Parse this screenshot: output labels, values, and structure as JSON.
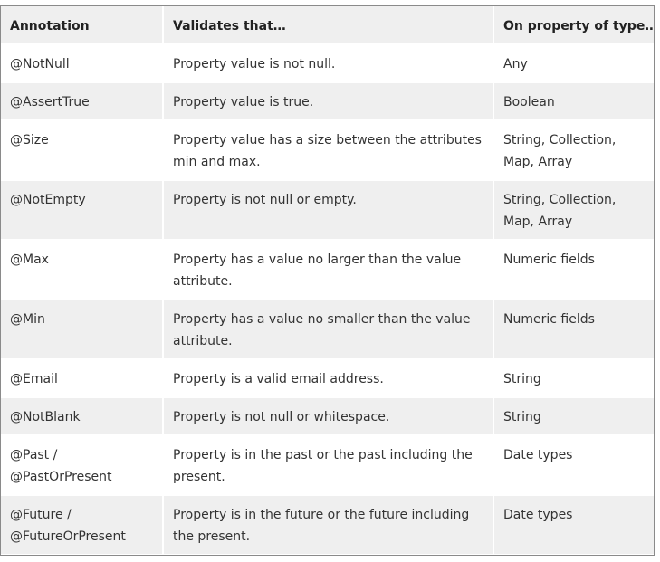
{
  "table": {
    "headers": [
      "Annotation",
      "Validates that…",
      "On property of type…"
    ],
    "rows": [
      [
        "@NotNull",
        "Property value is not null.",
        "Any"
      ],
      [
        "@AssertTrue",
        "Property value is true.",
        "Boolean"
      ],
      [
        "@Size",
        "Property value has a size between the attributes min and max.",
        "String, Collection, Map, Array"
      ],
      [
        "@NotEmpty",
        "Property is not null or empty.",
        "String, Collection, Map, Array"
      ],
      [
        "@Max",
        "Property has a value no larger than the value attribute.",
        "Numeric fields"
      ],
      [
        "@Min",
        "Property has a value no smaller than the value attribute.",
        "Numeric fields"
      ],
      [
        "@Email",
        "Property is a valid email address.",
        "String"
      ],
      [
        "@NotBlank",
        "Property is not null or whitespace.",
        "String"
      ],
      [
        "@Past / @PastOrPresent",
        "Property is in the past or the past including the present.",
        "Date types"
      ],
      [
        "@Future / @FutureOrPresent",
        "Property is in the future or the future including the present.",
        "Date types"
      ]
    ]
  }
}
